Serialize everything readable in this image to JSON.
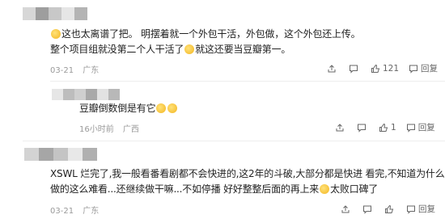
{
  "comments": [
    {
      "lines": [
        "这也太离谱了把。 明摆着就一个外包干活，外包做，这个外包还上传。",
        "整个项目组就没第二个人干活了",
        "就这还要当豆瓣第一。"
      ],
      "date": "03-21",
      "location": "广东",
      "likes": "121",
      "reply_label": "回复"
    },
    {
      "lines": [
        "豆瓣倒数倒是有它"
      ],
      "date": "16小时前",
      "location": "广西",
      "likes": "1",
      "reply_label": "回复"
    },
    {
      "lines": [
        "XSWL 烂完了,我一般看番看剧都不会快进的,这2年的斗破,大部分都是快进 看完,不知道为什么，",
        "做的这么难看...还继续做干嘛...不如停播 好好整整后面的再上来",
        "太败口碑了"
      ],
      "date": "03-21",
      "location": "广东",
      "likes": "",
      "reply_label": "回复"
    }
  ],
  "colors": {
    "meta": "#9a9a9a",
    "divider": "#eeeeee"
  }
}
